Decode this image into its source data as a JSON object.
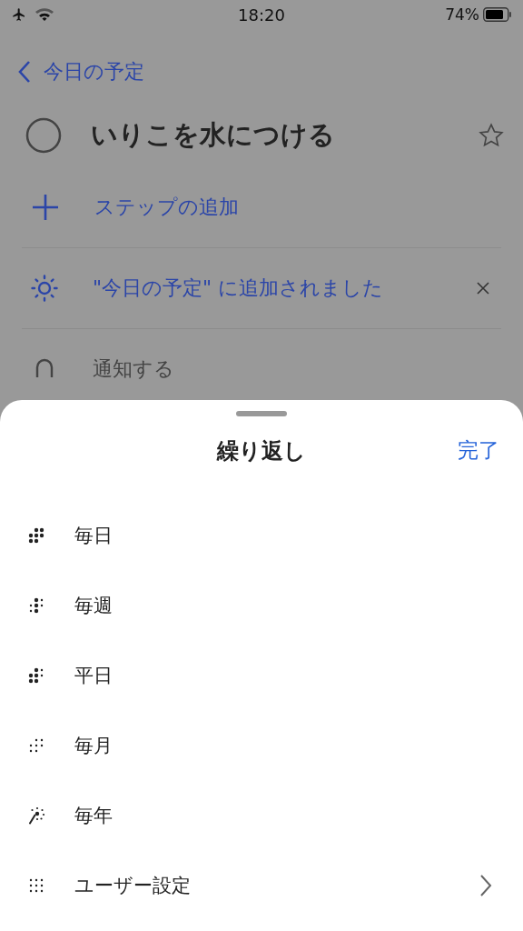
{
  "status_bar": {
    "time": "18:20",
    "battery": "74%"
  },
  "nav": {
    "back_label": "今日の予定"
  },
  "task": {
    "title": "いりこを水につける",
    "completed": false,
    "starred": false
  },
  "add_step": {
    "label": "ステップの追加"
  },
  "my_day": {
    "label": "\"今日の予定\" に追加されました"
  },
  "reminder": {
    "label": "通知する"
  },
  "sheet": {
    "title": "繰り返し",
    "done": "完了",
    "options": [
      {
        "kind": "daily",
        "label": "毎日",
        "chevron": false
      },
      {
        "kind": "weekly",
        "label": "毎週",
        "chevron": false
      },
      {
        "kind": "weekdays",
        "label": "平日",
        "chevron": false
      },
      {
        "kind": "monthly",
        "label": "毎月",
        "chevron": false
      },
      {
        "kind": "yearly",
        "label": "毎年",
        "chevron": false
      },
      {
        "kind": "custom",
        "label": "ユーザー設定",
        "chevron": true
      }
    ]
  }
}
